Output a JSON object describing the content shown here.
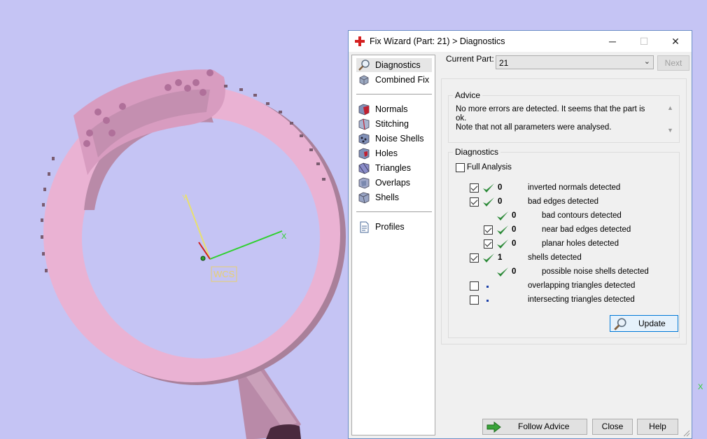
{
  "window": {
    "title": "Fix Wizard (Part: 21) > Diagnostics",
    "controls": {
      "minimize": "─",
      "maximize": "☐",
      "close": "✕"
    }
  },
  "viewport": {
    "background": "#c5c4f4",
    "model_color": "#f2b7db",
    "axis_x_label": "X",
    "axis_y_label": "Y",
    "wcs_label": "WCS"
  },
  "sidebar": {
    "items": [
      {
        "label": "Diagnostics",
        "icon": "magnifier-icon",
        "selected": true
      },
      {
        "label": "Combined Fix",
        "icon": "combined-fix-icon"
      },
      {
        "label": "Normals",
        "icon": "normals-cube-icon"
      },
      {
        "label": "Stitching",
        "icon": "stitching-cube-icon"
      },
      {
        "label": "Noise Shells",
        "icon": "noise-shells-cube-icon"
      },
      {
        "label": "Holes",
        "icon": "holes-cube-icon"
      },
      {
        "label": "Triangles",
        "icon": "triangles-cube-icon"
      },
      {
        "label": "Overlaps",
        "icon": "overlaps-cube-icon"
      },
      {
        "label": "Shells",
        "icon": "shells-cube-icon"
      },
      {
        "label": "Profiles",
        "icon": "profiles-document-icon"
      }
    ]
  },
  "part": {
    "label": "Current Part:",
    "value": "21",
    "next_label": "Next"
  },
  "advice": {
    "title": "Advice",
    "line1": "No more errors are detected. It seems that the part is ok.",
    "line2": "Note that not all parameters were analysed."
  },
  "diagnostics": {
    "title": "Diagnostics",
    "full_analysis_label": "Full Analysis",
    "full_analysis_checked": false,
    "rows": [
      {
        "checkbox": true,
        "checked": true,
        "status": "ok",
        "count": "0",
        "label": "inverted normals detected",
        "indent": 0
      },
      {
        "checkbox": true,
        "checked": true,
        "status": "ok",
        "count": "0",
        "label": "bad edges detected",
        "indent": 0
      },
      {
        "checkbox": false,
        "checked": false,
        "status": "ok",
        "count": "0",
        "label": "bad contours detected",
        "indent": 1
      },
      {
        "checkbox": true,
        "checked": true,
        "status": "ok",
        "count": "0",
        "label": "near bad edges detected",
        "indent": 1
      },
      {
        "checkbox": true,
        "checked": true,
        "status": "ok",
        "count": "0",
        "label": "planar holes detected",
        "indent": 1
      },
      {
        "checkbox": true,
        "checked": true,
        "status": "ok",
        "count": "1",
        "label": "shells detected",
        "indent": 0
      },
      {
        "checkbox": false,
        "checked": false,
        "status": "ok",
        "count": "0",
        "label": "possible noise shells detected",
        "indent": 1
      },
      {
        "checkbox": true,
        "checked": false,
        "status": "none",
        "count": "",
        "label": "overlapping triangles detected",
        "indent": 0
      },
      {
        "checkbox": true,
        "checked": false,
        "status": "none",
        "count": "",
        "label": "intersecting triangles detected",
        "indent": 0
      }
    ],
    "update_label": "Update"
  },
  "footer": {
    "follow_advice_label": "Follow Advice",
    "close_label": "Close",
    "help_label": "Help"
  },
  "colors": {
    "tick": "#2e8b3a",
    "accent": "#0078d7",
    "arrow": "#3aa33a"
  }
}
